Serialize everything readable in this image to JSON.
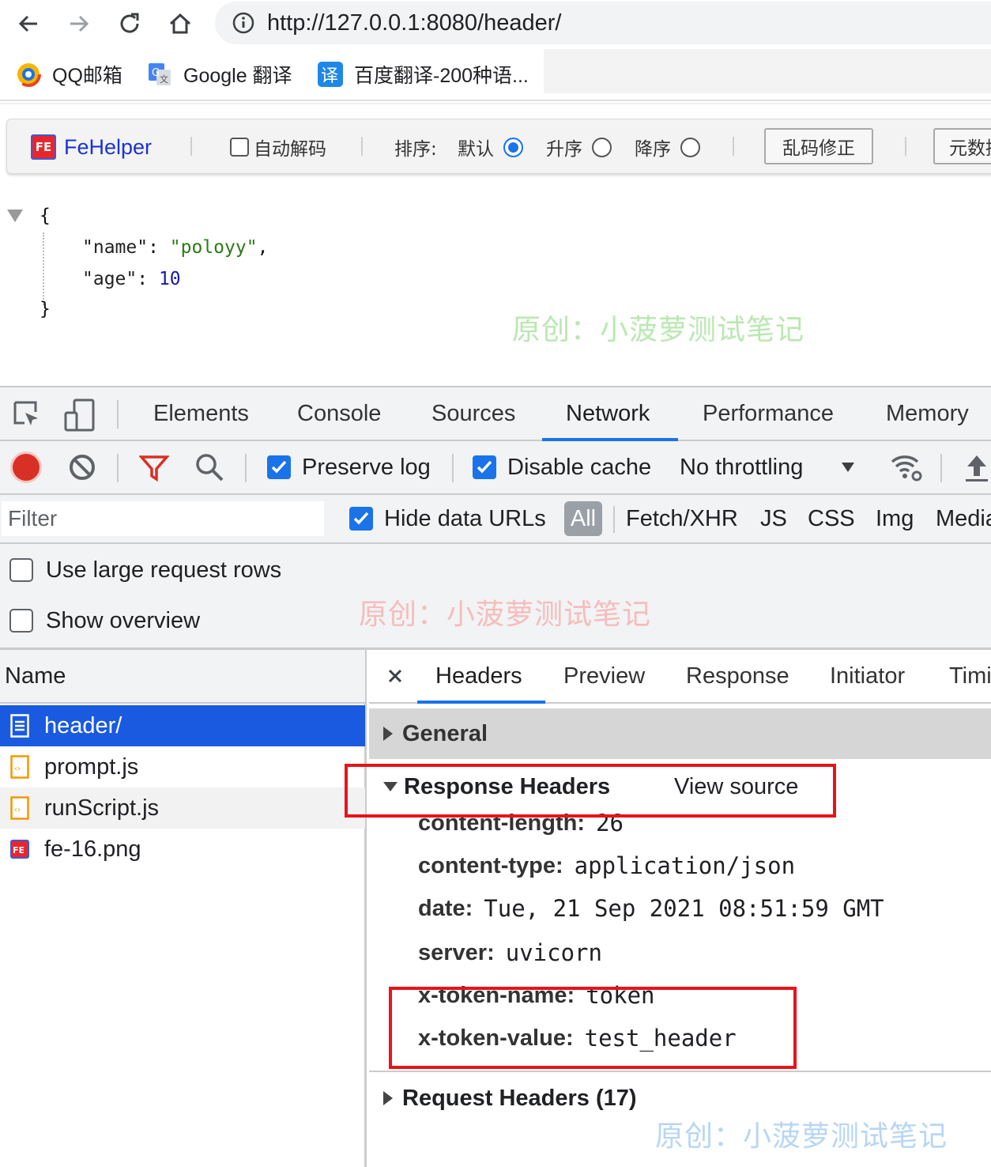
{
  "browser": {
    "url": "http://127.0.0.1:8080/header/",
    "bookmarks": [
      {
        "label": "QQ邮箱",
        "icon": "qq-mail-icon"
      },
      {
        "label": "Google 翻译",
        "icon": "google-translate-icon"
      },
      {
        "label": "百度翻译-200种语...",
        "icon": "baidu-translate-icon"
      }
    ]
  },
  "fehelper": {
    "brand": "FeHelper",
    "logo_text": "FE",
    "auto_decode_label": "自动解码",
    "sort_label": "排序:",
    "sort_default": "默认",
    "sort_asc": "升序",
    "sort_desc": "降序",
    "fix_button": "乱码修正",
    "meta_button": "元数据"
  },
  "json_view": {
    "open_brace": "{",
    "close_brace": "}",
    "key1": "\"name\"",
    "val1": "\"poloyy\"",
    "key2": "\"age\"",
    "val2": "10"
  },
  "watermark": "原创：小菠萝测试笔记",
  "devtools": {
    "tabs": [
      "Elements",
      "Console",
      "Sources",
      "Network",
      "Performance",
      "Memory"
    ],
    "active_tab": "Network",
    "preserve_log": "Preserve log",
    "disable_cache": "Disable cache",
    "throttling": "No throttling",
    "filter_placeholder": "Filter",
    "hide_data_urls": "Hide data URLs",
    "filter_types": [
      "All",
      "Fetch/XHR",
      "JS",
      "CSS",
      "Img",
      "Media"
    ],
    "use_large_rows": "Use large request rows",
    "show_overview": "Show overview",
    "name_header": "Name",
    "requests": [
      "header/",
      "prompt.js",
      "runScript.js",
      "fe-16.png"
    ],
    "detail_tabs": [
      "Headers",
      "Preview",
      "Response",
      "Initiator",
      "Timing"
    ],
    "general": "General",
    "response_headers": "Response Headers",
    "view_source": "View source",
    "headers": [
      {
        "key": "content-length:",
        "value": "26"
      },
      {
        "key": "content-type:",
        "value": "application/json"
      },
      {
        "key": "date:",
        "value": "Tue, 21 Sep 2021 08:51:59 GMT"
      },
      {
        "key": "server:",
        "value": "uvicorn"
      },
      {
        "key": "x-token-name:",
        "value": "token"
      },
      {
        "key": "x-token-value:",
        "value": "test_header"
      }
    ],
    "request_headers": "Request Headers (17)"
  },
  "colors": {
    "accent": "#1a73e8",
    "highlight": "#e8131b",
    "selected_row": "#1a5ae0"
  }
}
